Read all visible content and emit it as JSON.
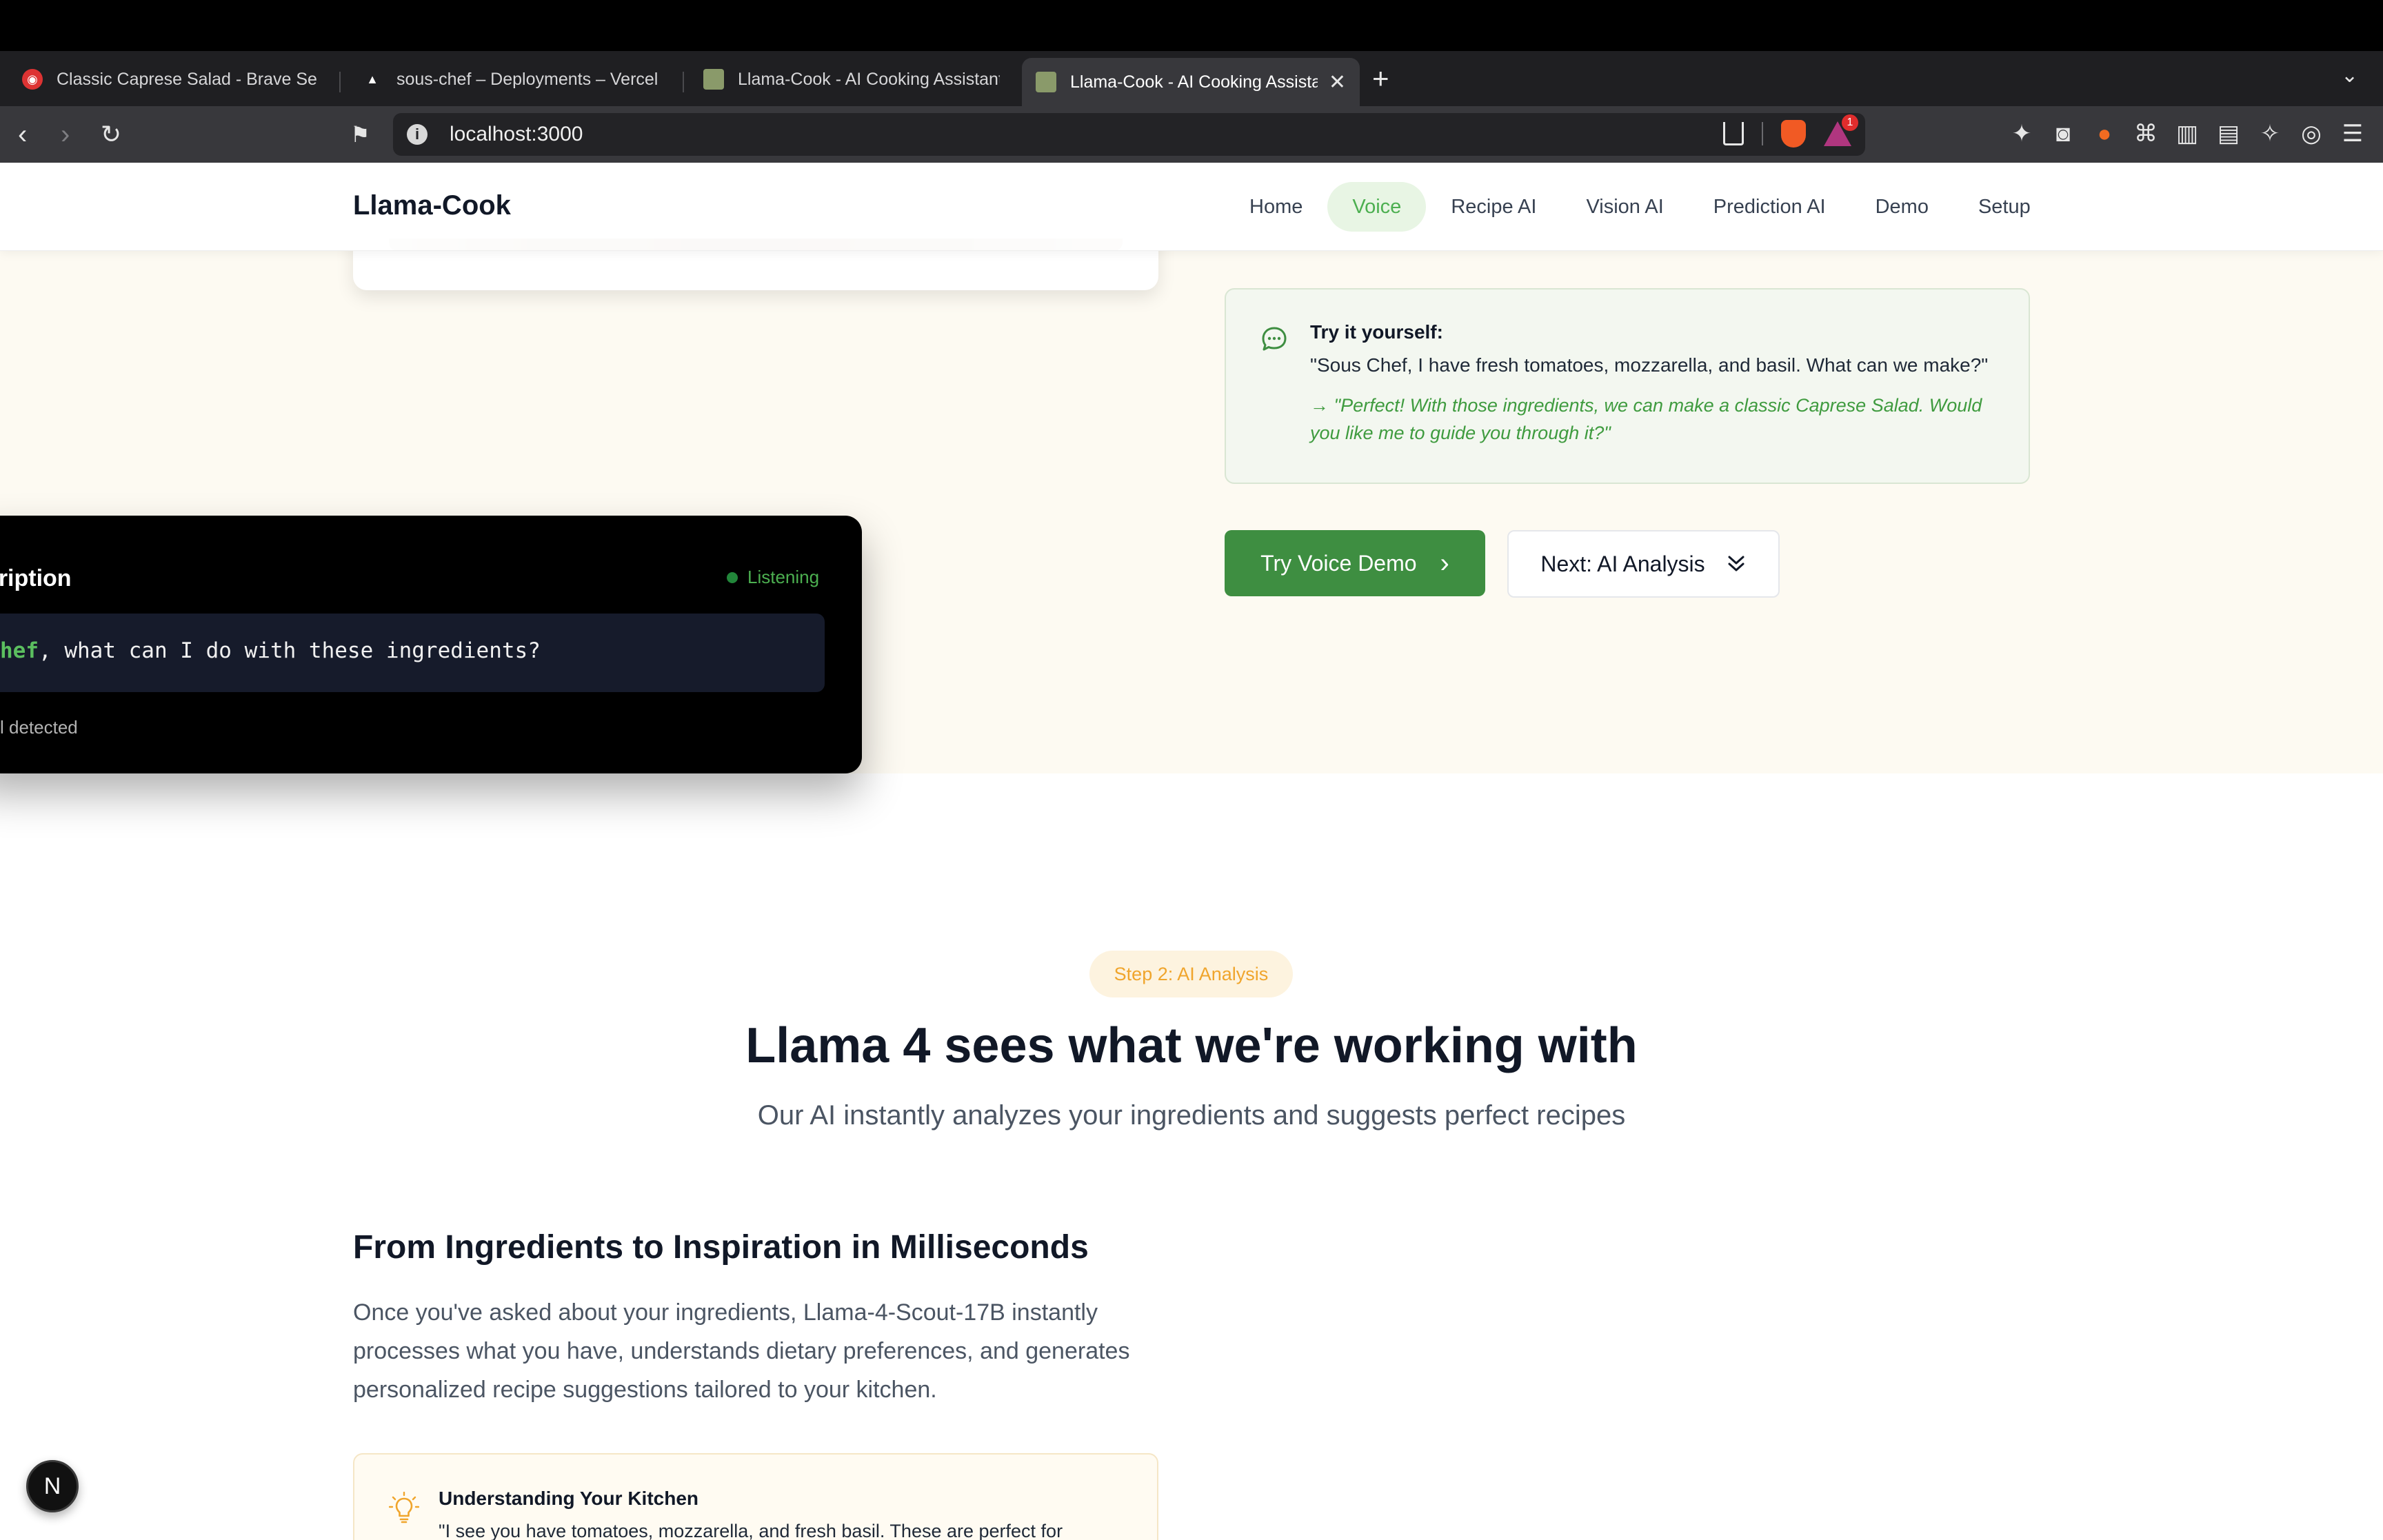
{
  "browser": {
    "tabs": [
      {
        "title": "Classic Caprese Salad - Brave Search",
        "icon": "brave-search-icon"
      },
      {
        "title": "sous-chef – Deployments – Vercel",
        "icon": "vercel-icon"
      },
      {
        "title": "Llama-Cook - AI Cooking Assistant",
        "icon": "llama-cook-favicon"
      },
      {
        "title": "Llama-Cook - AI Cooking Assistant",
        "icon": "llama-cook-favicon"
      }
    ],
    "url": "localhost:3000",
    "notification_count": "1"
  },
  "site": {
    "logo": "Llama-Cook",
    "nav": [
      "Home",
      "Voice",
      "Recipe AI",
      "Vision AI",
      "Prediction AI",
      "Demo",
      "Setup"
    ],
    "active_nav": "Voice"
  },
  "try_card": {
    "label": "Try it yourself:",
    "question": "\"Sous Chef, I have fresh tomatoes, mozzarella, and basil. What can we make?\"",
    "answer": "→ \"Perfect! With those ingredients, we can make a classic Caprese Salad. Would you like me to guide you through it?\""
  },
  "buttons": {
    "primary": "Try Voice Demo",
    "secondary": "Next: AI Analysis"
  },
  "transcription": {
    "title": "scription",
    "status": "Listening",
    "keyword": "hef",
    "text": ", what can I do with these ingredients?",
    "footer": "l detected"
  },
  "step": {
    "pill": "Step 2: AI Analysis",
    "title": "Llama 4 sees what we're working with",
    "subtitle": "Our AI instantly analyzes your ingredients and suggests perfect recipes"
  },
  "section": {
    "heading": "From Ingredients to Inspiration in Milliseconds",
    "paragraph": "Once you've asked about your ingredients, Llama-4-Scout-17B instantly processes what you have, understands dietary preferences, and generates personalized recipe suggestions tailored to your kitchen."
  },
  "kitchen_card": {
    "title": "Understanding Your Kitchen",
    "text": "\"I see you have tomatoes, mozzarella, and fresh basil. These are perfect for"
  },
  "nextjs_badge": "N",
  "colors": {
    "accent_green": "#3e8e41",
    "nav_active_bg": "#e8f5e4",
    "step_orange": "#f0a52c"
  }
}
